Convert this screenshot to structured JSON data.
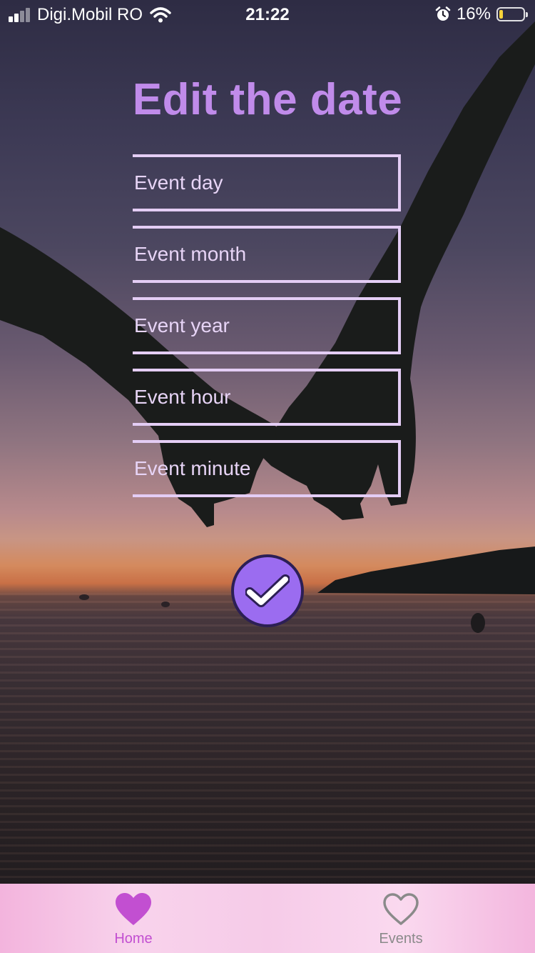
{
  "status_bar": {
    "carrier": "Digi.Mobil RO",
    "time": "21:22",
    "battery_percent": "16%",
    "battery_level": 0.16,
    "signal_icon": "signal-bars-icon",
    "wifi_icon": "wifi-icon",
    "alarm_icon": "alarm-clock-icon"
  },
  "page": {
    "title": "Edit the date"
  },
  "form": {
    "fields": [
      {
        "placeholder": "Event day",
        "value": ""
      },
      {
        "placeholder": "Event month",
        "value": ""
      },
      {
        "placeholder": "Event year",
        "value": ""
      },
      {
        "placeholder": "Event hour",
        "value": ""
      },
      {
        "placeholder": "Event minute",
        "value": ""
      }
    ],
    "confirm_icon": "checkmark-icon"
  },
  "tab_bar": {
    "tabs": [
      {
        "label": "Home",
        "icon": "heart-filled-icon",
        "active": true
      },
      {
        "label": "Events",
        "icon": "heart-outline-icon",
        "active": false
      }
    ]
  },
  "colors": {
    "title": "#c08bea",
    "field_border": "#e4cdf5",
    "confirm_fill": "#9b6cf0",
    "tab_active": "#c24fd1",
    "tab_inactive": "#8a8a8a"
  }
}
